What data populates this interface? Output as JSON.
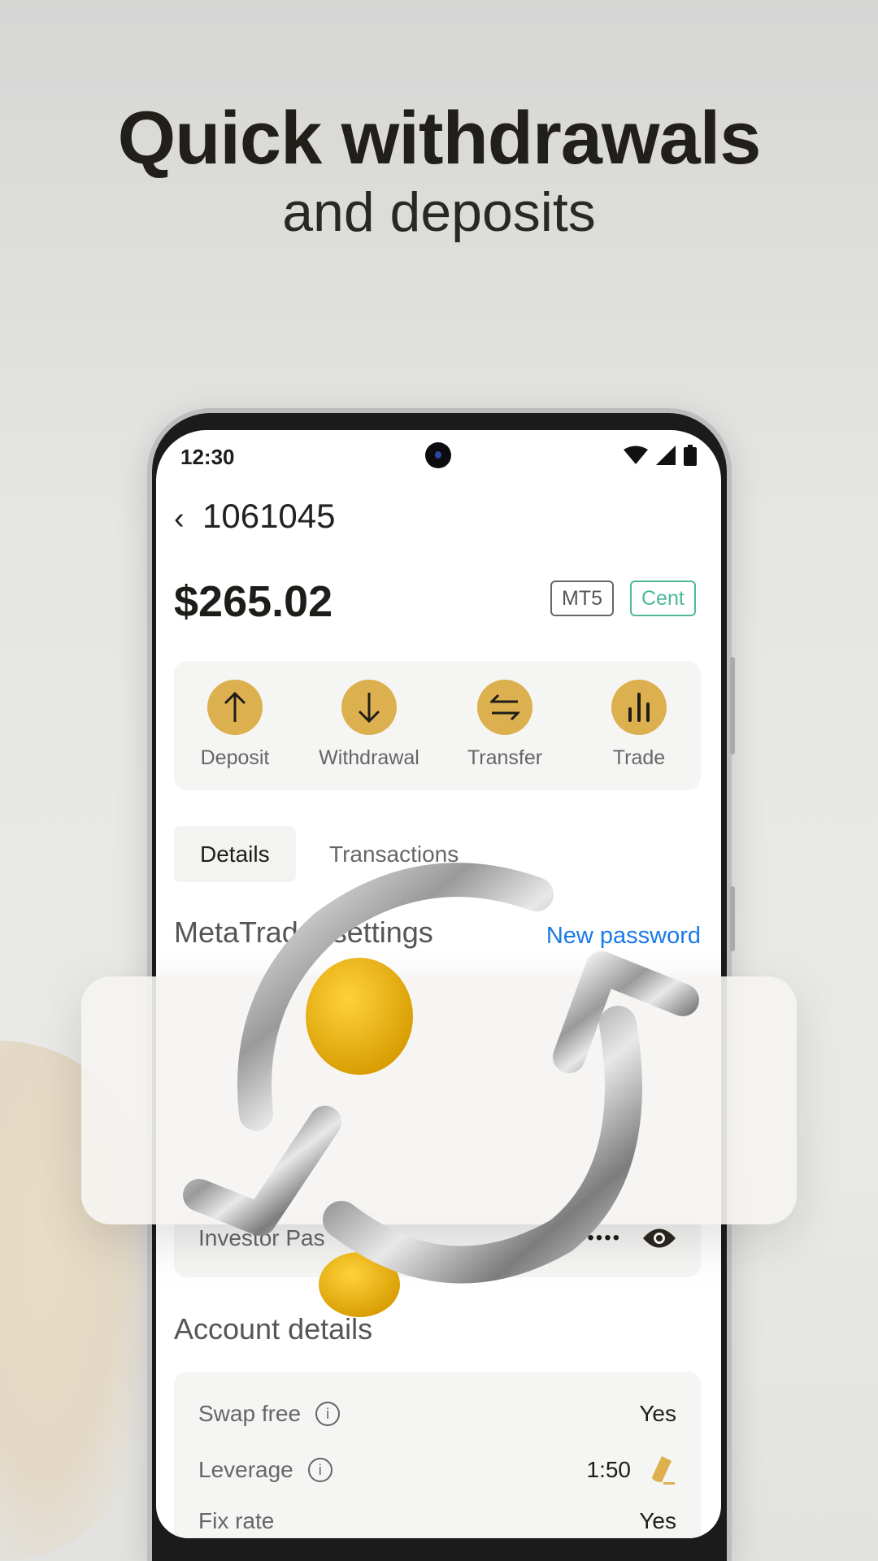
{
  "hero": {
    "title": "Quick withdrawals",
    "subtitle": "and deposits"
  },
  "status_bar": {
    "time": "12:30",
    "icons": [
      "wifi-icon",
      "signal-icon",
      "battery-icon"
    ]
  },
  "header": {
    "account_number": "1061045",
    "back_icon": "chevron-left-icon"
  },
  "balance": {
    "amount": "$265.02",
    "badges": [
      {
        "label": "MT5",
        "color": "#666666"
      },
      {
        "label": "Cent",
        "color": "#4fb89a"
      }
    ]
  },
  "actions": [
    {
      "label": "Deposit",
      "icon": "arrow-up-icon"
    },
    {
      "label": "Withdrawal",
      "icon": "arrow-down-icon"
    },
    {
      "label": "Transfer",
      "icon": "transfer-icon"
    },
    {
      "label": "Trade",
      "icon": "bar-chart-icon"
    }
  ],
  "tabs": [
    {
      "label": "Details",
      "active": true
    },
    {
      "label": "Transactions",
      "active": false
    }
  ],
  "metatrader": {
    "title": "MetaTrader settings",
    "title_visible": "MetaTrader settings",
    "new_password": "New password",
    "investor_label": "Investor Pas",
    "investor_value": "••••••"
  },
  "account_details": {
    "title": "Account details",
    "rows": [
      {
        "label": "Swap free",
        "value": "Yes",
        "info": true
      },
      {
        "label": "Leverage",
        "value": "1:50",
        "info": true,
        "editable": true
      },
      {
        "label": "Fix rate",
        "value": "Yes",
        "info": false
      }
    ]
  },
  "colors": {
    "accent": "#dcb04e",
    "link": "#1a7be6",
    "cent": "#4fb89a"
  }
}
